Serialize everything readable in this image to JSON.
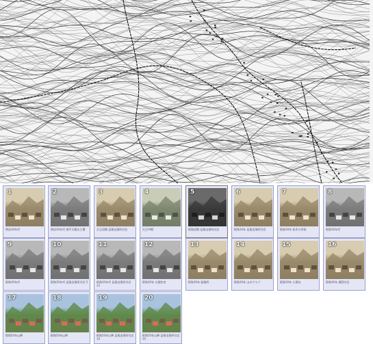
{
  "map": {
    "label": "topographic-map"
  },
  "thumbnails": [
    {
      "num": "1",
      "caption": "明治30年代",
      "tone": "sepia"
    },
    {
      "num": "2",
      "caption": "明治30年代 神戸大蔵水工場",
      "tone": "gray"
    },
    {
      "num": "3",
      "caption": "大正初期 足尾出張所付近",
      "tone": "sepia"
    },
    {
      "num": "4",
      "caption": "大正中期",
      "tone": "greenish"
    },
    {
      "num": "5",
      "caption": "昭和初期 足尾出張所付近",
      "tone": "dark"
    },
    {
      "num": "6",
      "caption": "昭和30年 足尾出張所付近",
      "tone": "sepia"
    },
    {
      "num": "7",
      "caption": "昭和30年 松木小学校",
      "tone": "sepia"
    },
    {
      "num": "8",
      "caption": "昭和30年代",
      "tone": "gray"
    },
    {
      "num": "9",
      "caption": "昭和30年代",
      "tone": "gray"
    },
    {
      "num": "10",
      "caption": "昭和30年代 足尾出張所付近 5",
      "tone": "gray"
    },
    {
      "num": "11",
      "caption": "昭和30年代 足尾出張所付近 12",
      "tone": "gray"
    },
    {
      "num": "12",
      "caption": "昭和30年 大畑住宅",
      "tone": "gray"
    },
    {
      "num": "13",
      "caption": "昭和30年 鉱務所",
      "tone": "sepia"
    },
    {
      "num": "14",
      "caption": "昭和30年 山のクラブ",
      "tone": "sepia"
    },
    {
      "num": "15",
      "caption": "昭和30年 小滝坑",
      "tone": "sepia"
    },
    {
      "num": "16",
      "caption": "昭和30年 通洞付近",
      "tone": "sepia"
    },
    {
      "num": "17",
      "caption": "昭和50年以降",
      "tone": "color"
    },
    {
      "num": "18",
      "caption": "昭和50年以降",
      "tone": "color"
    },
    {
      "num": "19",
      "caption": "昭和50年以降 足尾出張所付近 10",
      "tone": "color"
    },
    {
      "num": "20",
      "caption": "昭和50年以降 足尾出張所付近 20",
      "tone": "color"
    }
  ],
  "tones": {
    "sepia": {
      "sky": "#d8ccb0",
      "mid": "#9a8a6c",
      "ground": "#5e513e",
      "accent": "#eee3c8"
    },
    "gray": {
      "sky": "#b8b8b8",
      "mid": "#7c7c7c",
      "ground": "#444444",
      "accent": "#e6e6e6"
    },
    "greenish": {
      "sky": "#c9cdb8",
      "mid": "#7e8770",
      "ground": "#4d5546",
      "accent": "#e9ebdf"
    },
    "dark": {
      "sky": "#6a6a6a",
      "mid": "#3a3a3a",
      "ground": "#1e1e1e",
      "accent": "#d4d4d4"
    },
    "color": {
      "sky": "#a9c3df",
      "mid": "#5f8a4a",
      "ground": "#7a5a4a",
      "accent": "#d96c5a"
    }
  }
}
